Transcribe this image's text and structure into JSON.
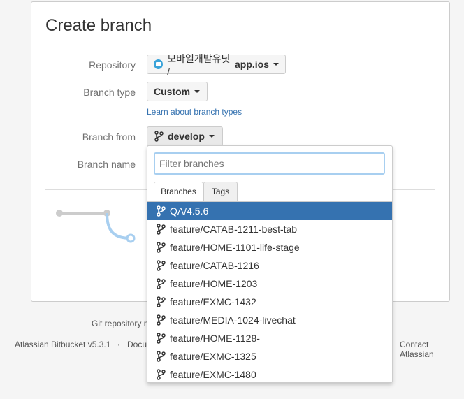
{
  "page": {
    "title": "Create branch",
    "labels": {
      "repository": "Repository",
      "branch_type": "Branch type",
      "branch_from": "Branch from",
      "branch_name": "Branch name"
    },
    "repository": {
      "project": "모바일개발유닛 /",
      "repo": "app.ios"
    },
    "branch_type": {
      "value": "Custom"
    },
    "learn_link": "Learn about branch types",
    "branch_from": {
      "value": "develop"
    }
  },
  "dropdown": {
    "filter_placeholder": "Filter branches",
    "tabs": [
      {
        "label": "Branches"
      },
      {
        "label": "Tags"
      }
    ],
    "items": [
      {
        "label": "QA/4.5.6"
      },
      {
        "label": "feature/CATAB-1211-best-tab"
      },
      {
        "label": "feature/HOME-1101-life-stage"
      },
      {
        "label": "feature/CATAB-1216"
      },
      {
        "label": "feature/HOME-1203"
      },
      {
        "label": "feature/EXMC-1432"
      },
      {
        "label": "feature/MEDIA-1024-livechat"
      },
      {
        "label": "feature/HOME-1128-"
      },
      {
        "label": "feature/EXMC-1325"
      },
      {
        "label": "feature/EXMC-1480"
      }
    ],
    "selected_index": 0
  },
  "footer": {
    "git_repo_text": "Git repository n",
    "version": "Atlassian Bitbucket v5.3.1",
    "separator": "·",
    "docs": "Docu",
    "contact": "Contact Atlassian"
  },
  "colors": {
    "accent": "#3572b0",
    "focus": "#a8cff0"
  }
}
